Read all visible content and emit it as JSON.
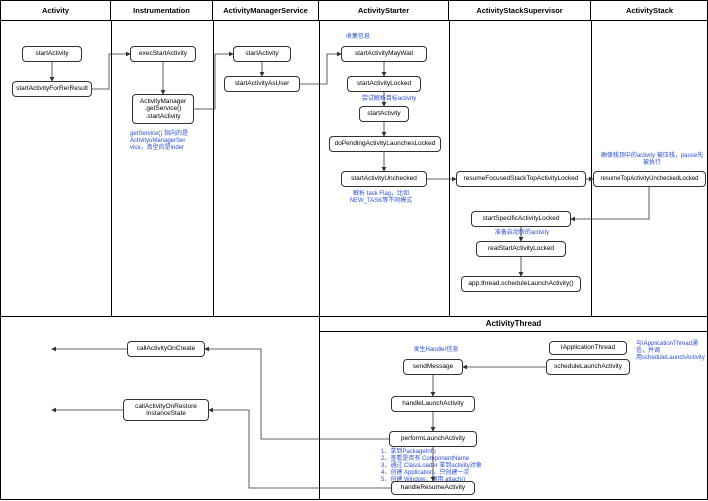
{
  "columns": [
    {
      "key": "activity",
      "label": "Activity"
    },
    {
      "key": "instrumentation",
      "label": "Instrumentation"
    },
    {
      "key": "ams",
      "label": "ActivityManagerService"
    },
    {
      "key": "starter",
      "label": "ActivityStarter"
    },
    {
      "key": "supervisor",
      "label": "ActivityStackSupervisor"
    },
    {
      "key": "stack",
      "label": "ActivityStack"
    }
  ],
  "sub_header": {
    "label": "ActivityThread"
  },
  "nodes": {
    "startActivity1": "startActivity",
    "startActivityForResult": "startActivityForRerResult",
    "execStartActivity": "execStartActivity",
    "amGetService": "ActivityManager\n.getService()\n.startActivity",
    "ams_startActivity": "startActivity",
    "ams_startActivityAsUser": "startActivityAsUser",
    "starter_mayWait": "startActivityMayWait",
    "starter_locked": "startActivityLocked",
    "starter_startActivity": "startActivity",
    "starter_doPending": "doPendingActivityLaunchesLocked",
    "starter_unchecked": "startActivityUnchecked",
    "sup_resumeFocused": "resumeFocusedStackTopActivityLocked",
    "stack_resumeTop": "resumeTopActivityUncheckedLocked",
    "sup_startSpecific": "startSpecificActivityLocked",
    "sup_realStart": "realStartActivityLocked",
    "sup_appThread": "app.thread.scheduleLaunchActivity()",
    "iAppThread": "IApplicationThread",
    "scheduleLaunch": "scheduleLaunchActivity",
    "sendMessage": "sendMessage",
    "handleLaunch": "handleLaunchActivity",
    "performLaunch": "performLaunchActivity",
    "handleResume": "handleResumeActivity",
    "callOnCreate": "callActivityOnCreate",
    "callOnRestore": "callActivityOnRestore\nInstanceState"
  },
  "annotations": {
    "getServiceNote": "getService() 指向的是\nActivityuManagerSer\nvice，真型的是inder",
    "collectInfo": "收集信息",
    "tryParse": "尝试解析目标activity",
    "taskFlag": "解析 task Flag，比如\nNEW_TASK等不同模式",
    "ensureStack": "确保栈顶中的activity 被压栈，pause先\n被执行",
    "prepareNew": "准备启动新的activity",
    "handlerMsg": "发生Handler信息",
    "iatNote": "与IApplicationThread通信，并调\n用scheduleLaunchActivity",
    "performList": "1、拿到PackageInfo\n2、查看是否有 ComponentName\n3、通过 ClassLoader 拿到activity对象\n4、创建 Application，只创建一次\n5、创建 Window，调用 attach()"
  }
}
